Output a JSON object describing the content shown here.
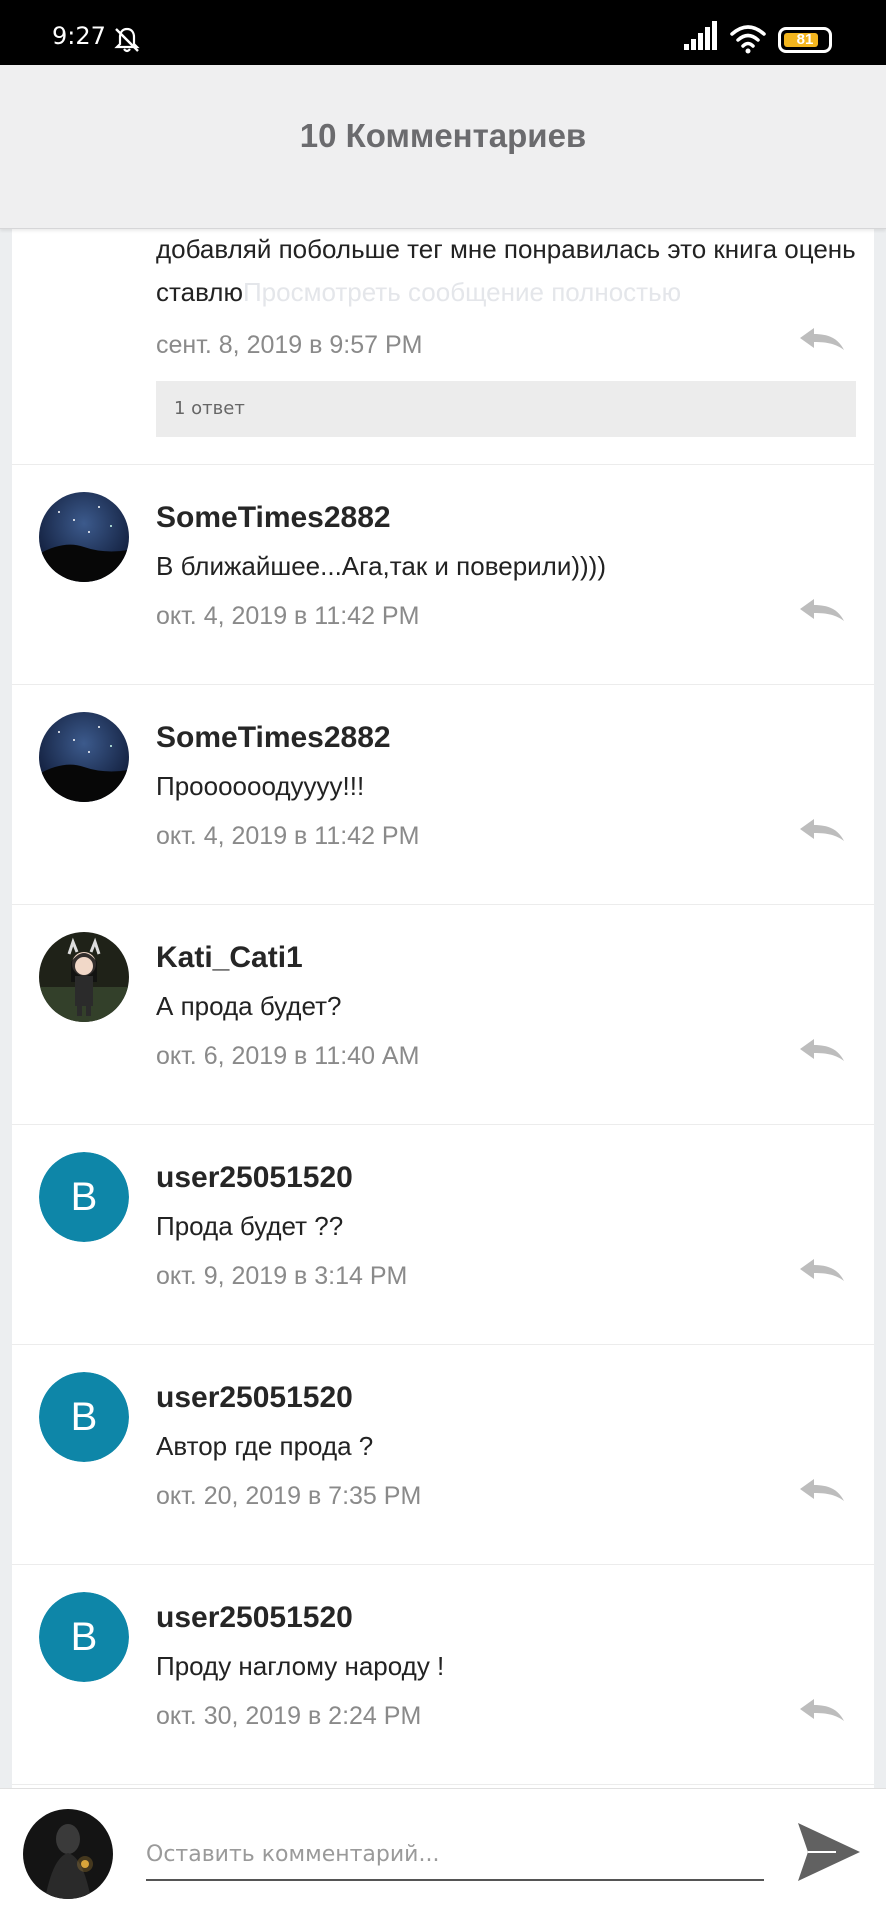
{
  "status_bar": {
    "time": "9:27",
    "battery": "81",
    "battery_level": 0.81,
    "battery_color": "#f2b51e"
  },
  "header": {
    "title": "10 Комментариев"
  },
  "first_comment": {
    "text": "добавляй побольше тег мне понравилась это книга оцень ставлю",
    "more_link": "Просмотреть сообщение полностью",
    "date": "сент. 8, 2019 в 9:57 PM",
    "replies_label": "1 ответ"
  },
  "comments": [
    {
      "username": "SomeTimes2882",
      "text": "В ближайшее...Ага,так и поверили))))",
      "date": "окт. 4, 2019 в 11:42 PM",
      "avatar": "night-sky"
    },
    {
      "username": "SomeTimes2882",
      "text": "Проооооодуууу!!!",
      "date": "окт. 4, 2019 в 11:42 PM",
      "avatar": "night-sky"
    },
    {
      "username": "Kati_Cati1",
      "text": "А прода будет?",
      "date": "окт. 6, 2019 в 11:40 AM",
      "avatar": "anime-character"
    },
    {
      "username": "user25051520",
      "text": "Прода будет ??",
      "date": "окт. 9, 2019 в 3:14 PM",
      "avatar": "letter",
      "initial": "B"
    },
    {
      "username": "user25051520",
      "text": "Автор где прода ?",
      "date": "окт. 20, 2019 в 7:35 PM",
      "avatar": "letter",
      "initial": "B"
    },
    {
      "username": "user25051520",
      "text": "Проду наглому народу !",
      "date": "окт. 30, 2019 в 2:24 PM",
      "avatar": "letter",
      "initial": "B"
    }
  ],
  "composer": {
    "placeholder": "Оставить комментарий..."
  },
  "colors": {
    "avatar_letter_bg": "#0e86a8",
    "header_bg": "#efeff0",
    "page_bg": "#eceef0"
  }
}
